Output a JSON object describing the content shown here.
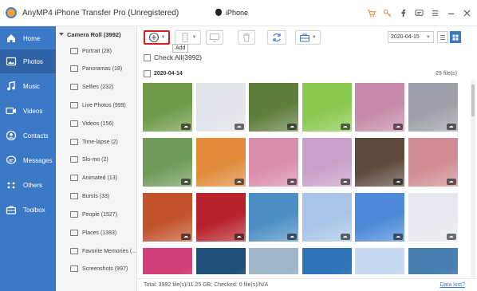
{
  "app": {
    "title": "AnyMP4 iPhone Transfer Pro (Unregistered)",
    "device": "iPhone"
  },
  "window_icons": [
    "cart-icon",
    "key-icon",
    "facebook-icon",
    "chat-icon",
    "menu-icon",
    "minimize-icon",
    "close-icon"
  ],
  "nav": {
    "items": [
      {
        "label": "Home",
        "icon": "home-icon"
      },
      {
        "label": "Photos",
        "icon": "photos-icon",
        "active": true
      },
      {
        "label": "Music",
        "icon": "music-icon"
      },
      {
        "label": "Videos",
        "icon": "videos-icon"
      },
      {
        "label": "Contacts",
        "icon": "contacts-icon"
      },
      {
        "label": "Messages",
        "icon": "messages-icon"
      },
      {
        "label": "Others",
        "icon": "others-icon"
      },
      {
        "label": "Toolbox",
        "icon": "toolbox-icon"
      }
    ]
  },
  "albums": {
    "header": "Camera Roll (3992)",
    "items": [
      {
        "label": "Portrait (28)"
      },
      {
        "label": "Panoramas (18)"
      },
      {
        "label": "Selfies (232)"
      },
      {
        "label": "Live Photos (999)"
      },
      {
        "label": "Videos (156)"
      },
      {
        "label": "Time-lapse (2)"
      },
      {
        "label": "Slo-mo (2)"
      },
      {
        "label": "Animated (13)"
      },
      {
        "label": "Bursts (33)"
      },
      {
        "label": "People (1527)"
      },
      {
        "label": "Places (1383)"
      },
      {
        "label": "Favorite Memories (..."
      },
      {
        "label": "Screenshots (997)"
      }
    ]
  },
  "toolbar": {
    "add_tooltip": "Add",
    "date_value": "2020-04-15"
  },
  "content": {
    "check_all": "Check All(3992)",
    "group_date": "2020-04-14",
    "group_count": "29 file(s)"
  },
  "thumbs": [
    "#6e9a4a",
    "#dfe4ea",
    "#5f7e3c",
    "#8ac94f",
    "#c58aa9",
    "#9ba0aa",
    "#6f9a58",
    "#e08a3a",
    "#d98cab",
    "#c9a0c9",
    "#5e4a3c",
    "#d18b93",
    "#c2522a",
    "#b8222b",
    "#4c8fc4",
    "#a8c4e8",
    "#4b88d8",
    "#e6e9ef",
    "#d1407a",
    "#1f4f7a",
    "#9fb6c9",
    "#2f74b8",
    "#c7d9ee",
    "#4a7fb4"
  ],
  "status": {
    "text": "Total: 3992 file(s)/11.25 GB; Checked: 0 file(s)/N/A",
    "data_lost": "Data lost?"
  },
  "colors": {
    "nav_bg": "#3b79c6",
    "nav_active": "#2f63a6",
    "add_highlight": "#d81e1e"
  }
}
